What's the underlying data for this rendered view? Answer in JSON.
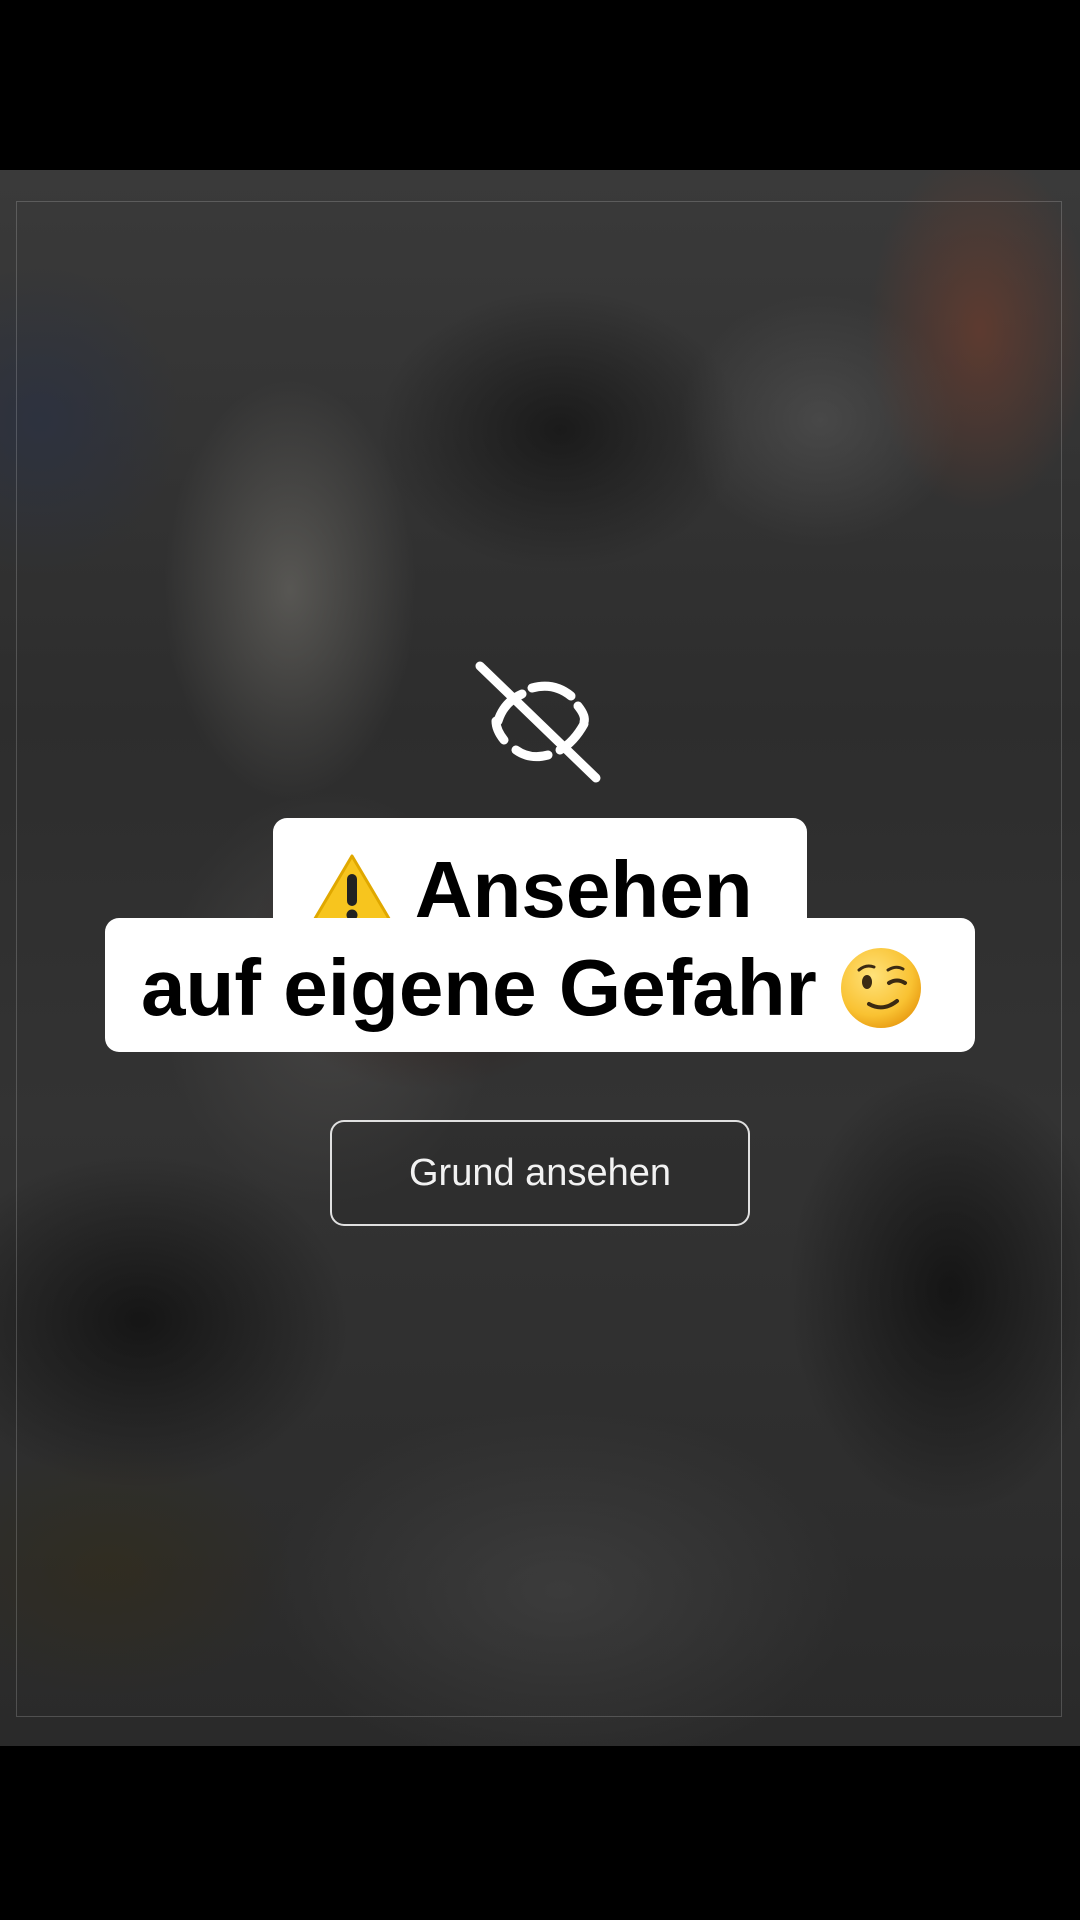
{
  "warning": {
    "icon": "eye-off-icon",
    "line1_emoji": "warning-emoji",
    "line1_text": "Ansehen",
    "line2_text": "auf eigene Gefahr",
    "line2_emoji": "winking-face-emoji",
    "button_label": "Grund ansehen"
  },
  "colors": {
    "caption_background": "#ffffff",
    "caption_text": "#000000",
    "button_border": "#ffffff",
    "icon": "#ffffff",
    "warning_yellow": "#f7c51e"
  }
}
